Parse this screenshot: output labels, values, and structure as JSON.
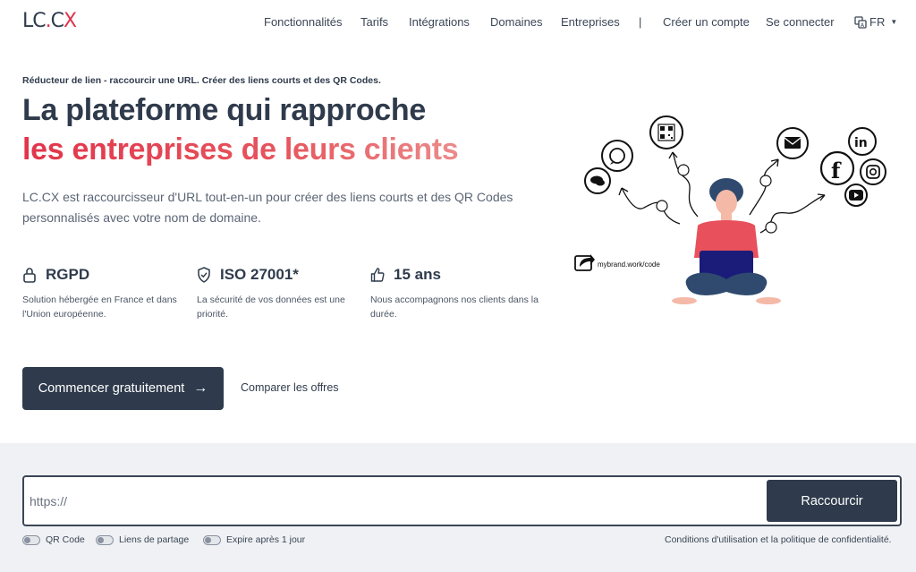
{
  "header": {
    "logo": {
      "part1": "LC",
      "dot": ".",
      "part2": "C",
      "x": "X"
    },
    "nav": [
      {
        "label": "Fonctionnalités"
      },
      {
        "label": "Tarifs"
      },
      {
        "label": "Intégrations"
      },
      {
        "label": "Domaines"
      },
      {
        "label": "Entreprises"
      },
      {
        "label": "|"
      },
      {
        "label": "Créer un compte"
      },
      {
        "label": "Se connecter"
      }
    ],
    "language": "FR"
  },
  "hero": {
    "tagline": "Réducteur de lien - raccourcir une URL. Créer des liens courts et des QR Codes.",
    "title_line1": "La plateforme qui rapproche",
    "title_line2": "les entreprises de leurs clients",
    "description": "LC.CX est raccourcisseur d'URL tout-en-un pour créer des liens courts et des QR Codes personnalisés avec votre nom de domaine.",
    "features": [
      {
        "icon": "lock-icon",
        "title": "RGPD",
        "text": "Solution hébergée en France et dans l'Union européenne."
      },
      {
        "icon": "shield-check-icon",
        "title": "ISO 27001*",
        "text": "La sécurité de vos données est une priorité."
      },
      {
        "icon": "thumbs-up-icon",
        "title": "15 ans",
        "text": "Nous accompagnons nos clients dans la durée."
      }
    ],
    "cta_label": "Commencer gratuitement",
    "cta_arrow": "→",
    "compare_label": "Comparer les offres",
    "illustration_link": "mybrand.work/code"
  },
  "shortener": {
    "placeholder": "https://",
    "button_label": "Raccourcir",
    "toggles": [
      {
        "label": "QR Code",
        "on": false
      },
      {
        "label": "Liens de partage",
        "on": false
      },
      {
        "label": "Expire après 1 jour",
        "on": false
      }
    ],
    "terms": "Conditions d'utilisation et la politique de confidentialité."
  },
  "colors": {
    "primary": "#2f3b4c",
    "accent": "#e2344a",
    "band": "#eff1f4",
    "shirt": "#e8505b",
    "pants": "#2f4a6e",
    "laptop": "#1b1b7a"
  }
}
